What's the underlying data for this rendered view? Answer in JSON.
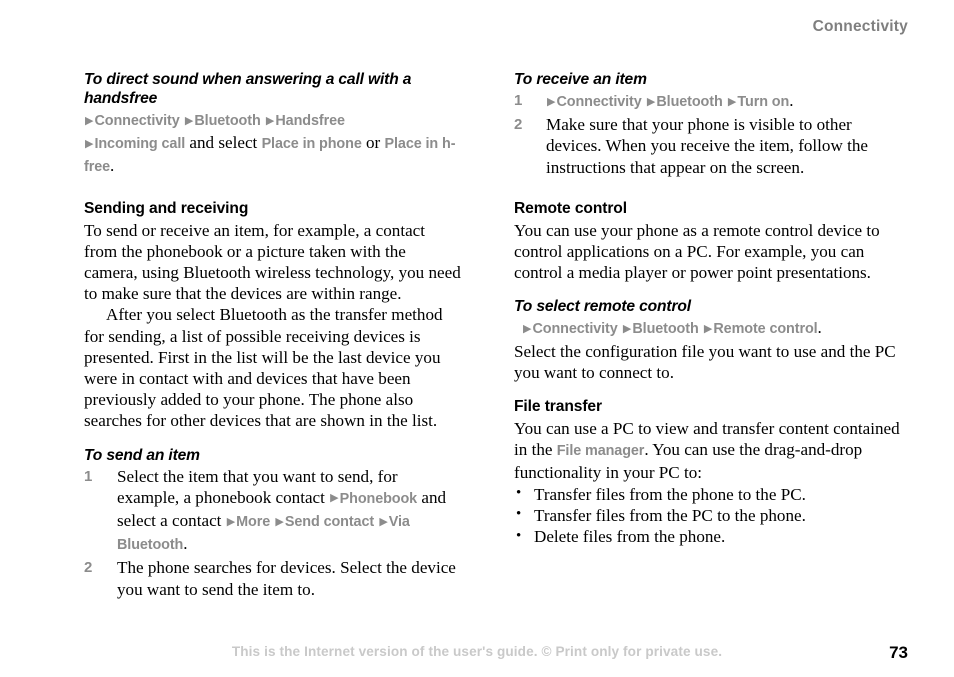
{
  "header": {
    "chapter_title": "Connectivity"
  },
  "arrow_glyph": "▶",
  "bullet_glyph": "•",
  "colors": {
    "menu_grey": "#8c8c8c",
    "header_grey": "#7f7f7f",
    "footer_grey": "#c9c9c9",
    "body_black": "#000000"
  },
  "left_column": {
    "task_handsfree": {
      "heading": "To direct sound when answering a call with a handsfree",
      "line1": {
        "arrow1": "▶",
        "item1": "Connectivity",
        "arrow2": "▶",
        "item2": "Bluetooth",
        "arrow3": "▶",
        "item3": "Handsfree"
      },
      "line2": {
        "arrow1": "▶",
        "item1": "Incoming call",
        "text1": " and select ",
        "item2": "Place in phone",
        "text2": " or ",
        "item3": "Place in h-free",
        "text3": "."
      }
    },
    "section_sending": {
      "heading": "Sending and receiving",
      "paragraph1": "To send or receive an item, for example, a contact from the phonebook or a picture taken with the camera, using Bluetooth wireless technology, you need to make sure that the devices are within range.",
      "paragraph2": "After you select Bluetooth as the transfer method for sending, a list of possible receiving devices is presented. First in the list will be the last device you were in contact with and devices that have been previously added to your phone. The phone also searches for other devices that are shown in the list."
    },
    "task_send_item": {
      "heading": "To send an item",
      "steps": [
        {
          "number": "1",
          "text_a": "Select the item that you want to send, for example, a phonebook contact ",
          "arrow1": "▶",
          "item1": "Phonebook",
          "text_b": " and select a contact ",
          "arrow2": "▶",
          "item2": "More",
          "arrow3": "▶",
          "item3": "Send contact",
          "arrow4": "▶",
          "item4": "Via Bluetooth",
          "text_c": "."
        },
        {
          "number": "2",
          "text": "The phone searches for devices. Select the device you want to send the item to."
        }
      ]
    }
  },
  "right_column": {
    "task_receive_item": {
      "heading": "To receive an item",
      "steps": [
        {
          "number": "1",
          "arrow1": "▶",
          "item1": "Connectivity",
          "arrow2": "▶",
          "item2": "Bluetooth",
          "arrow3": "▶",
          "item3": "Turn on",
          "text_end": "."
        },
        {
          "number": "2",
          "text": "Make sure that your phone is visible to other devices. When you receive the item, follow the instructions that appear on the screen."
        }
      ]
    },
    "section_remote_control": {
      "heading": "Remote control",
      "paragraph": "You can use your phone as a remote control device to control applications on a PC. For example, you can control a media player or power point presentations."
    },
    "task_select_remote": {
      "heading": "To select remote control",
      "menu_line": {
        "arrow1": "▶",
        "item1": "Connectivity",
        "arrow2": "▶",
        "item2": "Bluetooth",
        "arrow3": "▶",
        "item3": "Remote control",
        "text_end": "."
      },
      "paragraph": "Select the configuration file you want to use and the PC you want to connect to."
    },
    "section_file_transfer": {
      "heading": "File transfer",
      "paragraph_a": "You can use a PC to view and transfer content contained in the ",
      "inline_ref": "File manager",
      "paragraph_b": ". You can use the drag-and-drop functionality in your PC to:",
      "bullets": [
        "Transfer files from the phone to the PC.",
        "Transfer files from the PC to the phone.",
        "Delete files from the phone."
      ]
    }
  },
  "footer": {
    "note": "This is the Internet version of the user's guide. © Print only for private use.",
    "page_number": "73"
  }
}
